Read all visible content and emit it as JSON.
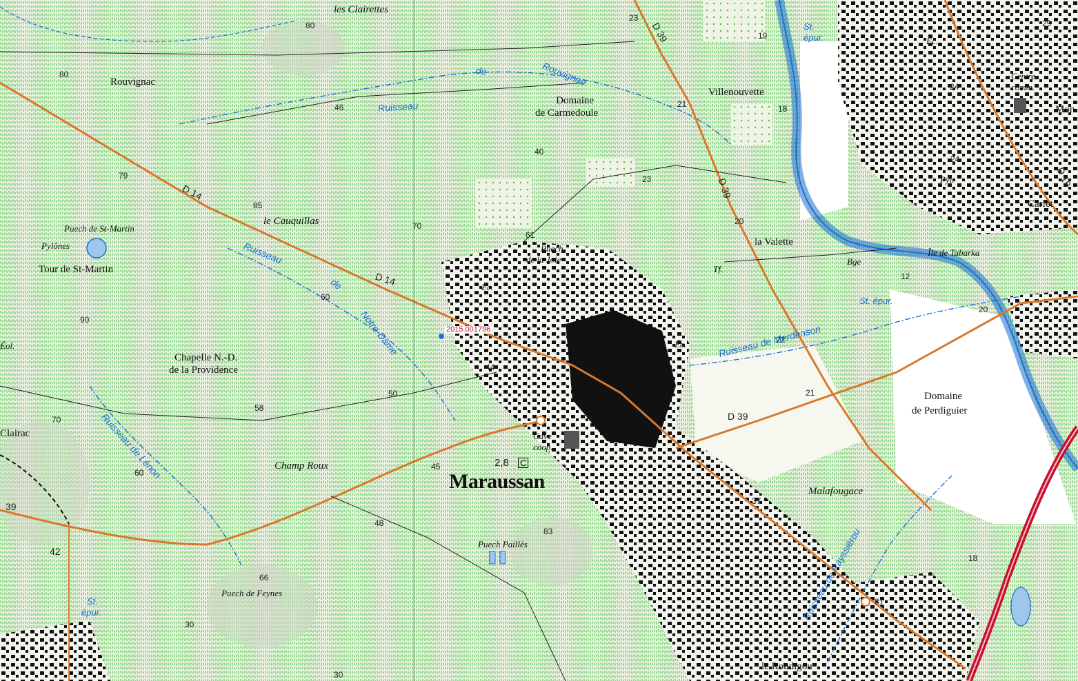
{
  "map": {
    "reference": "2015.001796",
    "labels": {
      "les_clairettes": "les Clairettes",
      "rouvignac": "Rouvignac",
      "domaine_carmedoule_1": "Domaine",
      "domaine_carmedoule_2": "de Carmedoule",
      "villenouvette": "Villenouvette",
      "ec_top": "Ec.",
      "centre_comm_1": "Centre",
      "centre_comm_2": "comm.",
      "mon": "Mon",
      "carlet": "Carlet",
      "pyl": "Pyl.",
      "la_valette": "la Valette",
      "bge": "Bge",
      "ile_tabarka": "Île de Tabarka",
      "tf": "Tf.",
      "puech_st_martin": "Puech de St-Martin",
      "pylones": "Pylônes",
      "tour_st_martin": "Tour de St-Martin",
      "le_cauquillas": "le Cauquillas",
      "puech_joie_1": "Puech",
      "puech_joie_2": "de la Joie",
      "ec_mid": "Éc.",
      "ec_center": "Éc.",
      "eol": "Éol.",
      "chapelle_1": "Chapelle N.-D.",
      "chapelle_2": "de la Providence",
      "clairac": "Clairac",
      "champ_roux": "Champ Roux",
      "cave_coop_1": "Cave",
      "cave_coop_2": "coop.",
      "maraussan": "Maraussan",
      "domaine_perdiguier_1": "Domaine",
      "domaine_perdiguier_2": "de Perdiguier",
      "malafougace": "Malafougace",
      "puech_pailles": "Puech Paillès",
      "puech_feynes": "Puech de Feynes",
      "le_roudigou": "le Roudigou",
      "c_symbol": "C"
    },
    "water_labels": {
      "ruisseau_de": "de",
      "ruisseau_rouvignac": "Rouvignac",
      "ruisseau_word": "Ruisseau",
      "ruisseau_notre_dame_1": "Ruisseau",
      "ruisseau_notre_dame_2": "de",
      "ruisseau_notre_dame_3": "Notre-Dame",
      "ruisseau_lenon": "Ruisseau de Lénon",
      "ruisseau_merdenson": "Ruisseau de Merdenson",
      "ruisseau_payssierou": "Ruisseau de Payssièrou",
      "st_epur_top_1": "St.",
      "st_epur_top_2": "épur.",
      "st_epur_mid": "St. épur.",
      "st_epur_bot_1": "St.",
      "st_epur_bot_2": "épur."
    },
    "roads": {
      "d39_top": "D 39",
      "d39_right": "D 39",
      "d39_center": "D 39",
      "d14_left": "D 14",
      "d14_mid": "D 14",
      "d19": "D 19",
      "r39": "39",
      "r42": "42"
    },
    "altitudes": {
      "a80_top": "80",
      "a80_left": "80",
      "a46": "46",
      "a79": "79",
      "a85": "85",
      "a23_top": "23",
      "a19": "19",
      "a21_top": "21",
      "a18_top": "18",
      "a40": "40",
      "a23_mid": "23",
      "a20_mid": "20",
      "a29": "29",
      "a24_a": "24",
      "a24_b": "24",
      "a61": "61",
      "a70_a": "70",
      "a60_a": "60",
      "a90": "90",
      "a12": "12",
      "a20_right": "20",
      "a22": "22",
      "a44": "44",
      "a50": "50",
      "a58": "58",
      "a70_b": "70",
      "a60_b": "60",
      "a21_b": "21",
      "a45": "45",
      "a28": "2,8",
      "a37": "37",
      "a48": "48",
      "a83": "83",
      "a18_b": "18",
      "a31": "31",
      "a66": "66",
      "a30_a": "30",
      "a30_b": "30"
    },
    "colors": {
      "vineyard": "#4cbf4a",
      "road_orange": "#d9782a",
      "river": "#1a6fd0",
      "motorway": "#c8102e",
      "building": "#111111",
      "land": "#eef3e4"
    }
  }
}
